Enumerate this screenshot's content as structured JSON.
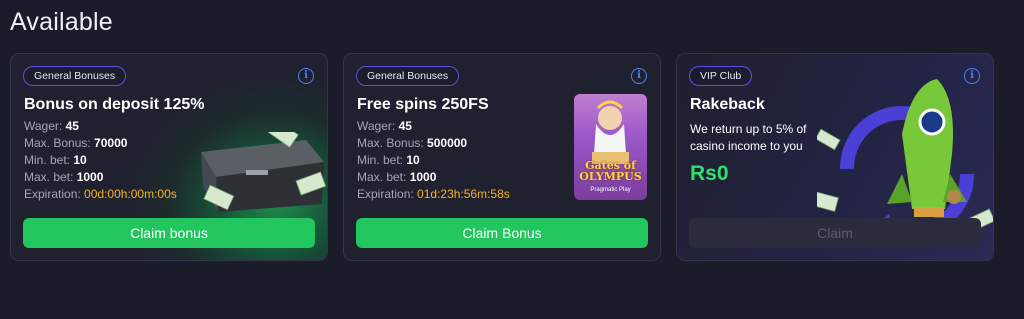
{
  "section_title": "Available",
  "cards": [
    {
      "tag": "General Bonuses",
      "title": "Bonus on deposit 125%",
      "rows": [
        {
          "label": "Wager:",
          "value": "45"
        },
        {
          "label": "Max. Bonus:",
          "value": "70000"
        },
        {
          "label": "Min. bet:",
          "value": "10"
        },
        {
          "label": "Max. bet:",
          "value": "1000"
        },
        {
          "label": "Expiration:",
          "value": "00d:00h:00m:00s"
        }
      ],
      "button": "Claim bonus"
    },
    {
      "tag": "General Bonuses",
      "title": "Free spins 250FS",
      "rows": [
        {
          "label": "Wager:",
          "value": "45"
        },
        {
          "label": "Max. Bonus:",
          "value": "500000"
        },
        {
          "label": "Min. bet:",
          "value": "10"
        },
        {
          "label": "Max. bet:",
          "value": "1000"
        },
        {
          "label": "Expiration:",
          "value": "01d:23h:56m:58s"
        }
      ],
      "game": {
        "logo": "Gates of OLYMPUS",
        "maker": "Pragmatic Play"
      },
      "button": "Claim Bonus"
    },
    {
      "tag": "VIP Club",
      "title": "Rakeback",
      "description": "We return up to 5% of casino income to you",
      "amount": "Rs0",
      "button": "Claim"
    }
  ],
  "icons": {
    "info": "info-icon"
  },
  "colors": {
    "accent_green": "#22c55e",
    "expiration": "#f0b429",
    "tag_border": "#5b4fe0",
    "info": "#4a82f5"
  }
}
